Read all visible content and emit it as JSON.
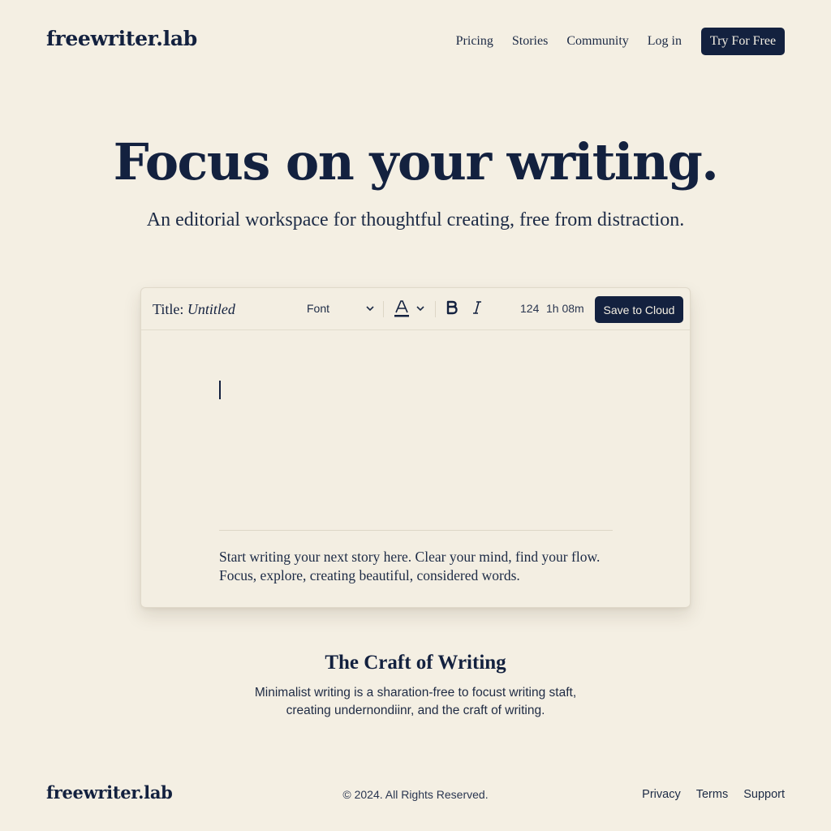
{
  "nav": {
    "logo": "freewriter.lab",
    "links": [
      "Pricing",
      "Stories",
      "Community",
      "Log in"
    ],
    "cta": "Try For Free"
  },
  "hero": {
    "title": "Focus on your writing.",
    "subtitle": "An editorial workspace for thoughtful creating, free from distraction."
  },
  "editor": {
    "title_label": "Title:",
    "title_value": "Untitled",
    "font_label": "Font",
    "word_count": "124",
    "time": "1h 08m",
    "save_label": "Save to Cloud",
    "placeholder_line1": "Start writing your next story here. Clear your mind, find your flow.",
    "placeholder_line2": "Focus, explore, creating beautiful, considered words."
  },
  "craft": {
    "title": "The Craft of Writing",
    "line1": "Minimalist writing is a sharation-free to focust writing staft,",
    "line2": "creating undernondiinr, and the craft of writing."
  },
  "footer": {
    "logo": "freewriter.lab",
    "copyright": "© 2024. All Rights Reserved.",
    "links": [
      "Privacy",
      "Terms",
      "Support"
    ]
  },
  "colors": {
    "background": "#f4efe3",
    "ink": "#13213f",
    "button": "#13213f"
  },
  "icons": {
    "font_dropdown": "chevron-down-icon",
    "text_color": "text-color-icon",
    "bold": "bold-icon",
    "italic": "italic-icon"
  }
}
